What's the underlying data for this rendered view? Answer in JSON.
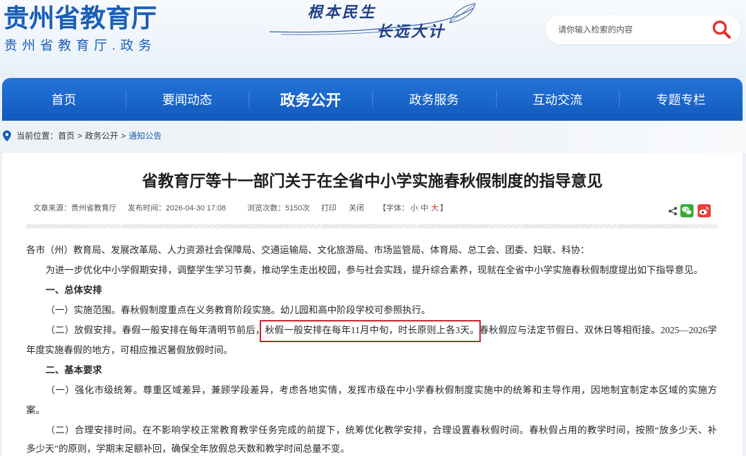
{
  "colors": {
    "brand_blue": "#1b5fb5",
    "nav_blue_top": "#2374d8",
    "nav_blue_bottom": "#1259bd",
    "link_blue": "#1a5fb4",
    "highlight_red": "#c8232c",
    "font_large_red": "#e3262b",
    "search_icon_red": "#e2322f",
    "wechat_green": "#3aa936",
    "weibo_red": "#e8403c"
  },
  "header": {
    "site_title": "贵州省教育厅",
    "site_subtitle": "贵州省教育厅.政务",
    "slogan": [
      "根本民生",
      "长远大计"
    ],
    "search": {
      "placeholder": "请你输入检索的内容",
      "icon": "search-icon"
    }
  },
  "nav": {
    "items": [
      {
        "label": "首页",
        "active": false
      },
      {
        "label": "要闻动态",
        "active": false
      },
      {
        "label": "政务公开",
        "active": true
      },
      {
        "label": "政务服务",
        "active": false
      },
      {
        "label": "互动交流",
        "active": false
      },
      {
        "label": "专题专栏",
        "active": false
      }
    ]
  },
  "breadcrumb": {
    "icon": "location-pin-icon",
    "prefix": "当前位置：",
    "separator": ">",
    "items": [
      "首页",
      "政务公开",
      "通知公告"
    ]
  },
  "article": {
    "title": "省教育厅等十一部门关于在全省中小学实施春秋假制度的指导意见",
    "meta": {
      "source": "文章来源：贵州省教育厅",
      "published": "发布时间：2026-04-30 17:08",
      "views": "浏览次数：5150次",
      "print": "打印",
      "close": "关闭",
      "font_size": {
        "open": "【字体：",
        "small": "小",
        "medium": "中",
        "large": "大",
        "close": "】"
      }
    },
    "share_icons": [
      "share-icon",
      "wechat-icon",
      "weibo-icon"
    ],
    "body": [
      {
        "text": "各市（州）教育局、发展改革局、人力资源社会保障局、交通运输局、文化旅游局、市场监管局、体育局、总工会、团委、妇联、科协："
      },
      {
        "text": "为进一步优化中小学假期安排，调整学生学习节奏，推动学生走出校园，参与社会实践，提升综合素养，现就在全省中小学实施春秋假制度提出如下指导意见。"
      },
      {
        "text": "一、总体安排",
        "bold": true
      },
      {
        "text": "（一）实施范围。春秋假制度重点在义务教育阶段实施。幼儿园和高中阶段学校可参照执行。"
      },
      {
        "segments": [
          {
            "text": "（二）放假安排。春假一般安排在每年清明节前后，"
          },
          {
            "text": "秋假一般安排在每年11月中旬，时长原则上各3天。",
            "highlight": true
          },
          {
            "text": "春秋假应与法定节假日、双休日等相衔接。2025—2026学"
          }
        ]
      },
      {
        "text": "年度实施春假的地方，可相应推迟暑假放假时间。"
      },
      {
        "text": "二、基本要求",
        "bold": true
      },
      {
        "text": "（一）强化市级统筹。尊重区域差异，兼顾学段差异，考虑各地实情，发挥市级在中小学春秋假制度实施中的统筹和主导作用，因地制宜制定本区域的实施方"
      },
      {
        "text": "案。"
      },
      {
        "text": "（二）合理安排时间。在不影响学校正常教育教学任务完成的前提下，统筹优化教学安排，合理设置春秋假时间。春秋假占用的教学时间，按照“放多少天、补"
      },
      {
        "text": "多少天”的原则，学期末足额补回，确保全年放假总天数和教学时间总量不变。"
      }
    ]
  }
}
